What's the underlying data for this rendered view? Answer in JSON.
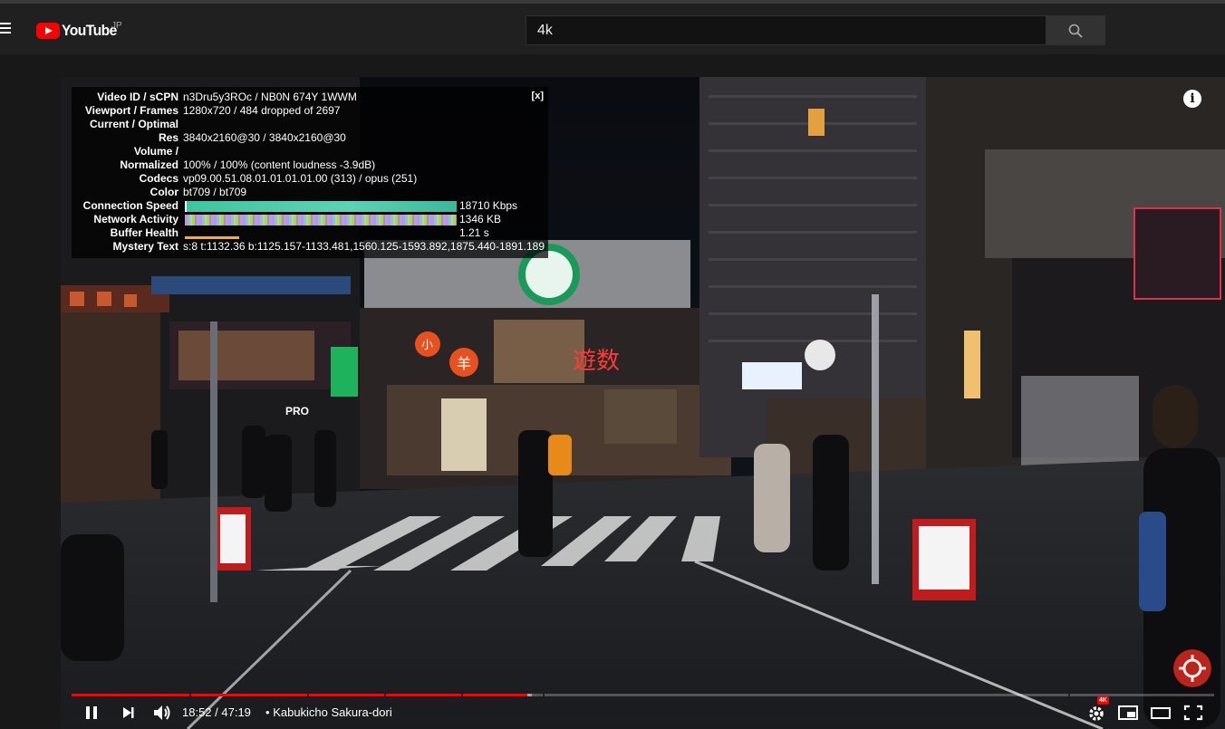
{
  "masthead": {
    "logo_text": "YouTube",
    "country_code": "JP",
    "search_value": "4k",
    "icons": {
      "menu": "menu-icon",
      "search": "search-icon"
    }
  },
  "stats": {
    "close_label": "[x]",
    "rows": [
      {
        "label": "Video ID / sCPN",
        "value": "n3Dru5y3ROc / NB0N 674Y 1WWM"
      },
      {
        "label": "Viewport / Frames",
        "value": "1280x720 / 484 dropped of 2697"
      },
      {
        "label": "Current / Optimal",
        "value": ""
      },
      {
        "label": "Res",
        "value": "3840x2160@30 / 3840x2160@30"
      },
      {
        "label": "Volume /",
        "value": ""
      },
      {
        "label": "Normalized",
        "value": "100% / 100% (content loudness -3.9dB)"
      },
      {
        "label": "Codecs",
        "value": "vp09.00.51.08.01.01.01.01.00 (313) / opus (251)"
      },
      {
        "label": "Color",
        "value": "bt709 / bt709"
      },
      {
        "label": "Connection Speed",
        "value": "18710 Kbps"
      },
      {
        "label": "Network Activity",
        "value": "1346 KB"
      },
      {
        "label": "Buffer Health",
        "value": "1.21 s"
      },
      {
        "label": "Mystery Text",
        "value": "s:8 t:1132.36 b:1125.157-1133.481,1560.125-1593.892,1875.440-1891.189"
      }
    ]
  },
  "player": {
    "info_label": "i",
    "time_display": "18:52 / 47:19",
    "separator": "•",
    "chapter_title": "Kabukicho Sakura-dori",
    "progress_fraction": 0.399,
    "buffered_fraction": 0.403,
    "quality_badge": "4K",
    "controls": {
      "play_pause": "pause-icon",
      "next": "next-icon",
      "volume": "volume-icon",
      "settings": "gear-icon",
      "miniplayer": "miniplayer-icon",
      "theater": "theater-icon",
      "fullscreen": "fullscreen-icon"
    }
  },
  "scene": {
    "signs": [
      "PRO",
      "遊数",
      "小",
      "羊"
    ]
  },
  "colors": {
    "accent": "#ff0000",
    "masthead_bg": "#202020",
    "page_bg": "#181818",
    "connection_bar": "#3ec6a0"
  }
}
